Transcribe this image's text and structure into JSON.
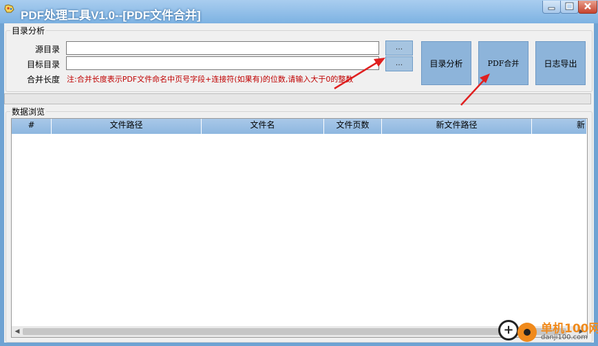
{
  "window": {
    "title": "PDF处理工具V1.0--[PDF文件合并]"
  },
  "directory_group": {
    "legend": "目录分析",
    "source_label": "源目录",
    "source_value": "",
    "target_label": "目标目录",
    "target_value": "",
    "merge_length_label": "合并长度",
    "browse_source_label": "...",
    "browse_target_label": "...",
    "note": "注:合并长度表示PDF文件命名中页号字段+连接符(如果有)的位数,请输入大于0的整数"
  },
  "buttons": {
    "analyze": "目录分析",
    "merge": "PDF合并",
    "export_log": "日志导出"
  },
  "progress": {
    "value": 0
  },
  "data_group": {
    "legend": "数据浏览",
    "columns": [
      "#",
      "文件路径",
      "文件名",
      "文件页数",
      "新文件路径",
      "新"
    ],
    "rows": []
  },
  "watermark": {
    "text": "单机100网",
    "domain": "danji100.com"
  },
  "colors": {
    "titlebar": "#7db2e2",
    "button": "#8db4da",
    "note": "#c00000",
    "annotation_arrow": "#e02020"
  }
}
